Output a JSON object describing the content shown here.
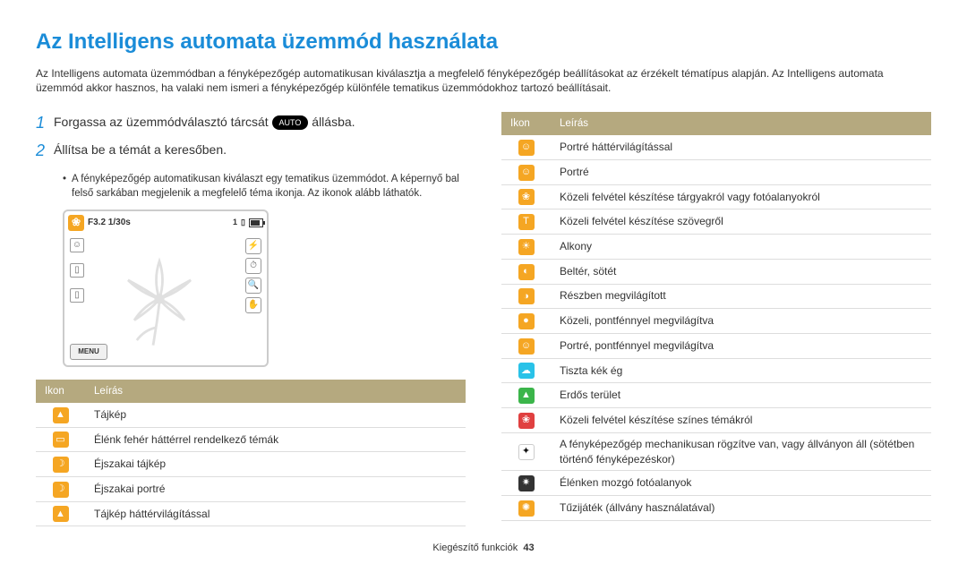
{
  "title": "Az Intelligens automata üzemmód használata",
  "intro": "Az Intelligens automata üzemmódban a fényképezőgép automatikusan kiválasztja a megfelelő fényképezőgép beállításokat az érzékelt tématípus alapján. Az Intelligens automata üzemmód akkor hasznos, ha valaki nem ismeri a fényképezőgép különféle tematikus üzemmódokhoz tartozó beállításait.",
  "steps": {
    "s1_pre": "Forgassa az üzemmódválasztó tárcsát ",
    "s1_badge": "AUTO",
    "s1_post": " állásba.",
    "s2": "Állítsa be a témát a keresőben."
  },
  "bullet": "A fényképezőgép automatikusan kiválaszt egy tematikus üzemmódot. A képernyő bal felső sarkában megjelenik a megfelelő téma ikonja. Az ikonok alább láthatók.",
  "preview": {
    "exposure": "F3.2 1/30s",
    "counter": "1",
    "menu": "MENU"
  },
  "th_icon": "Ikon",
  "th_desc": "Leírás",
  "left_rows": [
    {
      "color": "ic-orange",
      "glyph": "▲",
      "name": "landscape-icon",
      "desc": "Tájkép"
    },
    {
      "color": "ic-orange",
      "glyph": "▭",
      "name": "white-bg-icon",
      "desc": "Élénk fehér háttérrel rendelkező témák"
    },
    {
      "color": "ic-orange",
      "glyph": "☽",
      "name": "night-landscape-icon",
      "desc": "Éjszakai tájkép"
    },
    {
      "color": "ic-orange",
      "glyph": "☽",
      "name": "night-portrait-icon",
      "desc": "Éjszakai portré"
    },
    {
      "color": "ic-orange",
      "glyph": "▲",
      "name": "backlit-landscape-icon",
      "desc": "Tájkép háttérvilágítással"
    }
  ],
  "right_rows": [
    {
      "color": "ic-orange",
      "glyph": "☺",
      "name": "backlit-portrait-icon",
      "desc": "Portré háttérvilágítással"
    },
    {
      "color": "ic-orange",
      "glyph": "☺",
      "name": "portrait-icon",
      "desc": "Portré"
    },
    {
      "color": "ic-orange",
      "glyph": "❀",
      "name": "macro-object-icon",
      "desc": "Közeli felvétel készítése tárgyakról vagy fotóalanyokról"
    },
    {
      "color": "ic-orange",
      "glyph": "T",
      "name": "macro-text-icon",
      "desc": "Közeli felvétel készítése szövegről"
    },
    {
      "color": "ic-orange",
      "glyph": "☀",
      "name": "sunset-icon",
      "desc": "Alkony"
    },
    {
      "color": "ic-orange",
      "glyph": "◐",
      "name": "indoor-dark-icon",
      "desc": "Beltér, sötét"
    },
    {
      "color": "ic-orange",
      "glyph": "◑",
      "name": "partial-light-icon",
      "desc": "Részben megvilágított"
    },
    {
      "color": "ic-orange",
      "glyph": "●",
      "name": "close-spotlight-icon",
      "desc": "Közeli, pontfénnyel megvilágítva"
    },
    {
      "color": "ic-orange",
      "glyph": "☺",
      "name": "portrait-spotlight-icon",
      "desc": "Portré, pontfénnyel megvilágítva"
    },
    {
      "color": "ic-blue",
      "glyph": "☁",
      "name": "blue-sky-icon",
      "desc": "Tiszta kék ég"
    },
    {
      "color": "ic-green",
      "glyph": "▲",
      "name": "forest-icon",
      "desc": "Erdős terület"
    },
    {
      "color": "ic-red",
      "glyph": "❀",
      "name": "macro-color-icon",
      "desc": "Közeli felvétel készítése színes témákról"
    },
    {
      "color": "ic-white",
      "glyph": "✦",
      "name": "tripod-icon",
      "desc": "A fényképezőgép mechanikusan rögzítve van, vagy állványon áll (sötétben történő fényképezéskor)"
    },
    {
      "color": "ic-dark",
      "glyph": "✷",
      "name": "moving-subject-icon",
      "desc": "Élénken mozgó fotóalanyok"
    },
    {
      "color": "ic-orange",
      "glyph": "✺",
      "name": "fireworks-icon",
      "desc": "Tűzijáték (állvány használatával)"
    }
  ],
  "footer_label": "Kiegészítő funkciók",
  "footer_page": "43"
}
